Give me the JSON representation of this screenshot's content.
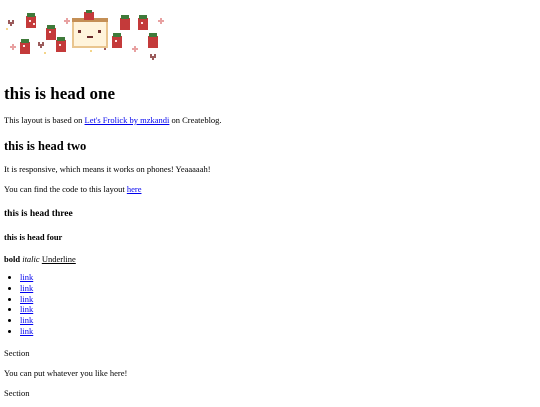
{
  "head_one": "this is head one",
  "intro": {
    "before": "This layout is based on ",
    "link": "Let's Frolick by mzkandi",
    "after": " on Createblog."
  },
  "head_two": "this is head two",
  "responsive_text": "It is responsive, which means it works on phones! Yeaaaaah!",
  "code": {
    "before": "You can find the code to this layout ",
    "link": "here"
  },
  "head_three": "this is head three",
  "head_four": "this is head four",
  "formatting": {
    "bold": "bold",
    "italic": "italic",
    "underline": "Underline"
  },
  "links": [
    "link",
    "link",
    "link",
    "link",
    "link",
    "link"
  ],
  "sections": [
    {
      "title": "Section",
      "body": "You can put whatever you like here!"
    },
    {
      "title": "Section"
    }
  ],
  "colors": {
    "link": "#0000ee",
    "strawberry": "#c43a3a",
    "accent_dark": "#6b2b2b"
  }
}
